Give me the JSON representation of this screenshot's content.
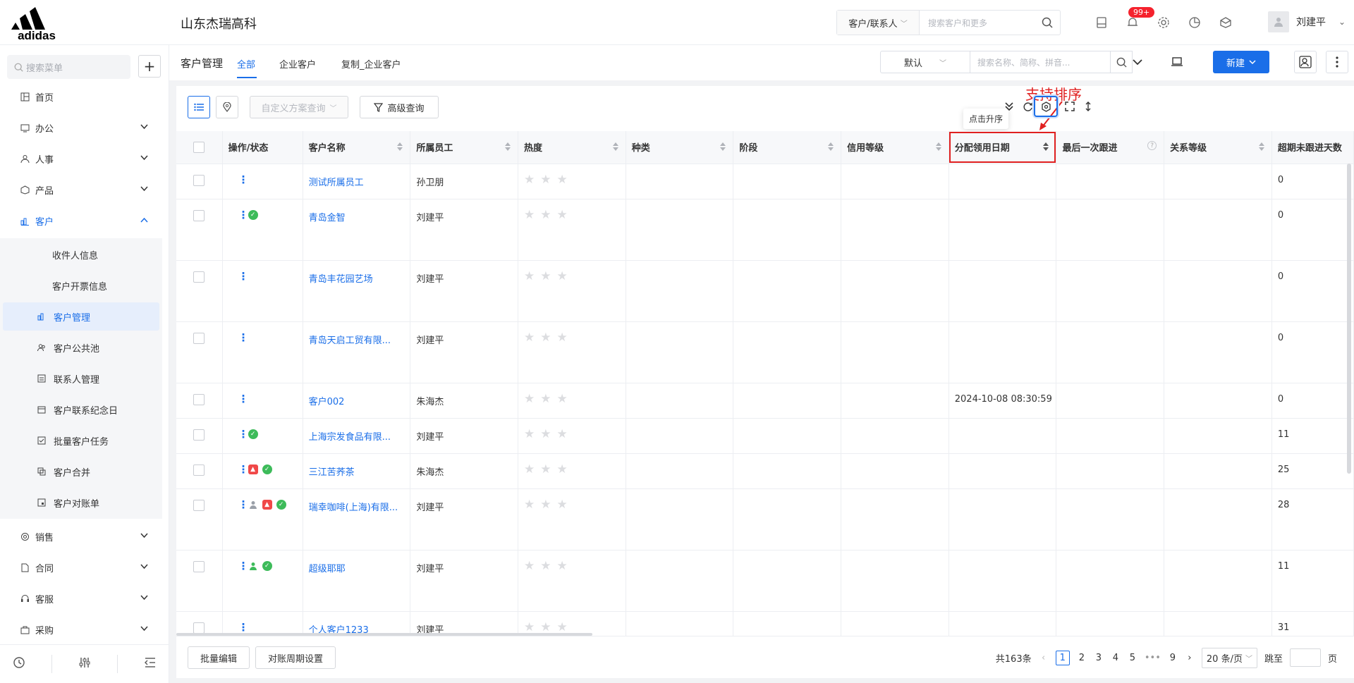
{
  "brand": {
    "logo_text": "adidas"
  },
  "company": "山东杰瑞高科",
  "topsearch": {
    "scope": "客户/联系人",
    "placeholder": "搜索客户和更多"
  },
  "notifications": {
    "badge": "99+"
  },
  "user": {
    "name": "刘建平"
  },
  "sidebar": {
    "search_placeholder": "搜索菜单",
    "items": [
      {
        "label": "首页",
        "icon": "home-icon"
      },
      {
        "label": "办公",
        "icon": "office-icon"
      },
      {
        "label": "人事",
        "icon": "hr-icon"
      },
      {
        "label": "产品",
        "icon": "product-icon"
      },
      {
        "label": "客户",
        "icon": "customer-icon"
      },
      {
        "label": "销售",
        "icon": "sales-icon"
      },
      {
        "label": "合同",
        "icon": "contract-icon"
      },
      {
        "label": "客服",
        "icon": "service-icon"
      },
      {
        "label": "采购",
        "icon": "purchase-icon"
      }
    ],
    "sub_items": [
      {
        "label": "收件人信息"
      },
      {
        "label": "客户开票信息"
      },
      {
        "label": "客户管理"
      },
      {
        "label": "客户公共池"
      },
      {
        "label": "联系人管理"
      },
      {
        "label": "客户联系纪念日"
      },
      {
        "label": "批量客户任务"
      },
      {
        "label": "客户合并"
      },
      {
        "label": "客户对账单"
      }
    ]
  },
  "subheader": {
    "title": "客户管理",
    "tabs": [
      "全部",
      "企业客户",
      "复制_企业客户"
    ],
    "view_select": "默认",
    "search_placeholder": "搜索名称、简称、拼音...",
    "new_button": "新建"
  },
  "toolbar": {
    "custom_query_placeholder": "自定义方案查询",
    "advanced_query": "高级查询",
    "tooltip": "点击升序",
    "annotation": "支持排序"
  },
  "table": {
    "columns": [
      "操作/状态",
      "客户名称",
      "所属员工",
      "热度",
      "种类",
      "阶段",
      "信用等级",
      "分配领用日期",
      "最后一次跟进",
      "关系等级",
      "超期未跟进天数"
    ],
    "rows": [
      {
        "name": "测试所属员工",
        "employee": "孙卫朋",
        "date": "",
        "overdue": "0",
        "status": []
      },
      {
        "name": "青岛金智",
        "employee": "刘建平",
        "date": "",
        "overdue": "0",
        "status": [
          "ok"
        ]
      },
      {
        "name": "青岛丰花园艺场",
        "employee": "刘建平",
        "date": "",
        "overdue": "0",
        "status": []
      },
      {
        "name": "青岛天启工贸有限...",
        "employee": "刘建平",
        "date": "",
        "overdue": "0",
        "status": []
      },
      {
        "name": "客户002",
        "employee": "朱海杰",
        "date": "2024-10-08 08:30:59",
        "overdue": "0",
        "status": []
      },
      {
        "name": "上海宗发食品有限...",
        "employee": "刘建平",
        "date": "",
        "overdue": "11",
        "status": [
          "ok"
        ]
      },
      {
        "name": "三江苦荞茶",
        "employee": "朱海杰",
        "date": "",
        "overdue": "25",
        "status": [
          "warn",
          "ok"
        ]
      },
      {
        "name": "瑞幸咖啡(上海)有限...",
        "employee": "刘建平",
        "date": "",
        "overdue": "28",
        "status": [
          "user-gray",
          "warn",
          "ok"
        ]
      },
      {
        "name": "超级耶耶",
        "employee": "刘建平",
        "date": "",
        "overdue": "11",
        "status": [
          "user-green",
          "ok"
        ]
      },
      {
        "name": "个人客户1233",
        "employee": "刘建平",
        "date": "",
        "overdue": "31",
        "status": []
      }
    ]
  },
  "footer": {
    "batch_edit": "批量编辑",
    "period_settings": "对账周期设置",
    "total": "共163条",
    "pages": [
      "1",
      "2",
      "3",
      "4",
      "5",
      "•••",
      "9"
    ],
    "current_page": "1",
    "page_size": "20 条/页",
    "goto_label": "跳至",
    "page_unit": "页"
  }
}
